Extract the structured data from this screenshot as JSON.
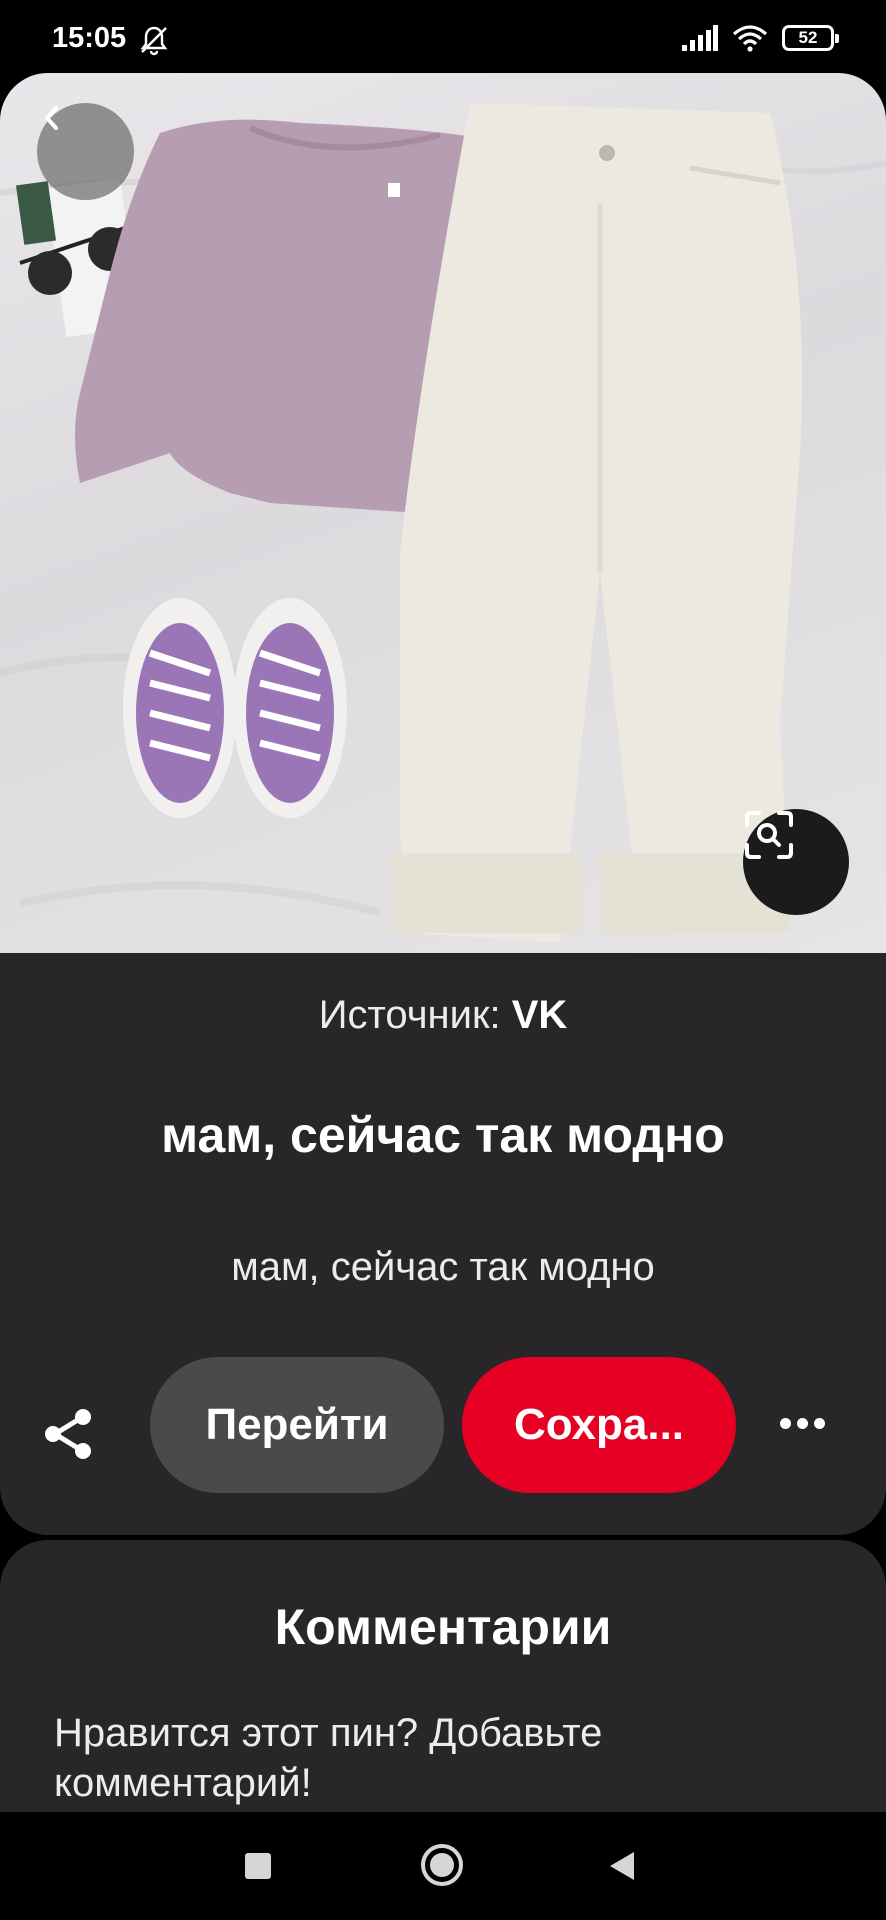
{
  "status_bar": {
    "time": "15:05",
    "battery": "52",
    "icons": [
      "dnd-bell-off-icon",
      "signal-icon",
      "wifi-icon",
      "battery-icon"
    ]
  },
  "pin": {
    "image_alt": "outfit-photo",
    "source_label": "Источник:",
    "source_name": "VK",
    "title": "мам, сейчас так модно",
    "description": "мам, сейчас так модно",
    "visit_label": "Перейти",
    "save_label": "Сохра...",
    "icons": [
      "back-chevron-icon",
      "visual-search-icon",
      "share-icon",
      "more-dots-icon"
    ]
  },
  "comments": {
    "title": "Комментарии",
    "prompt": "Нравится этот пин? Добавьте комментарий!"
  },
  "colors": {
    "card_bg": "#282629",
    "save_red": "#e60023",
    "visit_gray": "#4a4a4b"
  }
}
